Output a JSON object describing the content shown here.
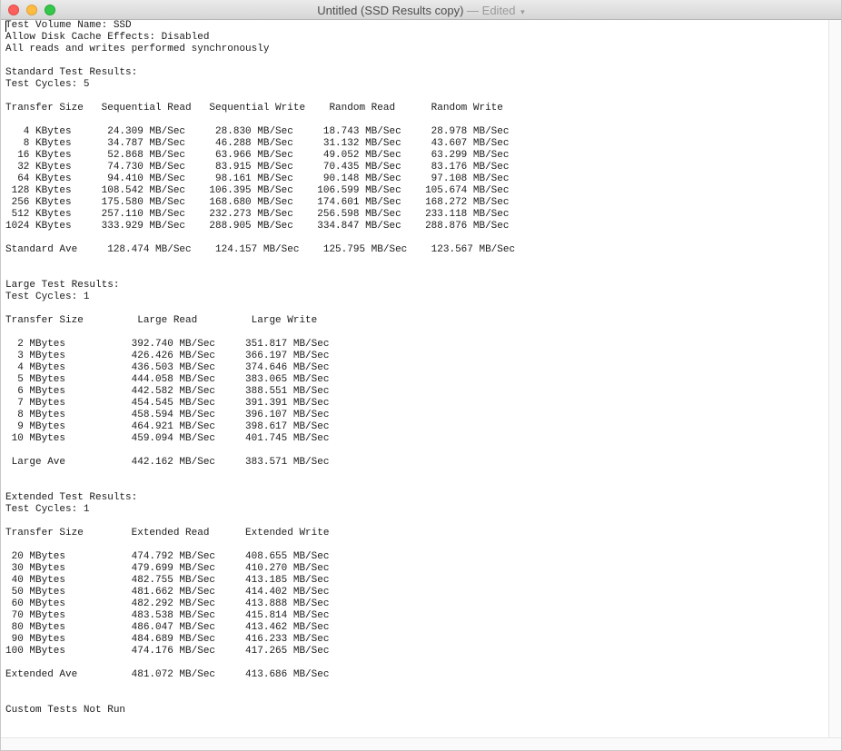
{
  "window": {
    "title": "Untitled (SSD Results copy)",
    "status": "— Edited",
    "chevron_icon": "chevron-down-icon"
  },
  "document": {
    "text": "Test Volume Name: SSD\nAllow Disk Cache Effects: Disabled\nAll reads and writes performed synchronously\n\nStandard Test Results:\nTest Cycles: 5\n\nTransfer Size   Sequential Read   Sequential Write    Random Read      Random Write\n\n   4 KBytes      24.309 MB/Sec     28.830 MB/Sec     18.743 MB/Sec     28.978 MB/Sec\n   8 KBytes      34.787 MB/Sec     46.288 MB/Sec     31.132 MB/Sec     43.607 MB/Sec\n  16 KBytes      52.868 MB/Sec     63.966 MB/Sec     49.052 MB/Sec     63.299 MB/Sec\n  32 KBytes      74.730 MB/Sec     83.915 MB/Sec     70.435 MB/Sec     83.176 MB/Sec\n  64 KBytes      94.410 MB/Sec     98.161 MB/Sec     90.148 MB/Sec     97.108 MB/Sec\n 128 KBytes     108.542 MB/Sec    106.395 MB/Sec    106.599 MB/Sec    105.674 MB/Sec\n 256 KBytes     175.580 MB/Sec    168.680 MB/Sec    174.601 MB/Sec    168.272 MB/Sec\n 512 KBytes     257.110 MB/Sec    232.273 MB/Sec    256.598 MB/Sec    233.118 MB/Sec\n1024 KBytes     333.929 MB/Sec    288.905 MB/Sec    334.847 MB/Sec    288.876 MB/Sec\n\nStandard Ave     128.474 MB/Sec    124.157 MB/Sec    125.795 MB/Sec    123.567 MB/Sec\n\n\nLarge Test Results:\nTest Cycles: 1\n\nTransfer Size         Large Read         Large Write\n\n  2 MBytes           392.740 MB/Sec     351.817 MB/Sec\n  3 MBytes           426.426 MB/Sec     366.197 MB/Sec\n  4 MBytes           436.503 MB/Sec     374.646 MB/Sec\n  5 MBytes           444.058 MB/Sec     383.065 MB/Sec\n  6 MBytes           442.582 MB/Sec     388.551 MB/Sec\n  7 MBytes           454.545 MB/Sec     391.391 MB/Sec\n  8 MBytes           458.594 MB/Sec     396.107 MB/Sec\n  9 MBytes           464.921 MB/Sec     398.617 MB/Sec\n 10 MBytes           459.094 MB/Sec     401.745 MB/Sec\n\n Large Ave           442.162 MB/Sec     383.571 MB/Sec\n\n\nExtended Test Results:\nTest Cycles: 1\n\nTransfer Size        Extended Read      Extended Write\n\n 20 MBytes           474.792 MB/Sec     408.655 MB/Sec\n 30 MBytes           479.699 MB/Sec     410.270 MB/Sec\n 40 MBytes           482.755 MB/Sec     413.185 MB/Sec\n 50 MBytes           481.662 MB/Sec     414.402 MB/Sec\n 60 MBytes           482.292 MB/Sec     413.888 MB/Sec\n 70 MBytes           483.538 MB/Sec     415.814 MB/Sec\n 80 MBytes           486.047 MB/Sec     413.462 MB/Sec\n 90 MBytes           484.689 MB/Sec     416.233 MB/Sec\n100 MBytes           474.176 MB/Sec     417.265 MB/Sec\n\nExtended Ave         481.072 MB/Sec     413.686 MB/Sec\n\n\nCustom Tests Not Run"
  },
  "colors": {
    "close": "#fc605c",
    "minimize": "#fdbc40",
    "zoom": "#34c84a",
    "text": "#1a1a1a"
  }
}
